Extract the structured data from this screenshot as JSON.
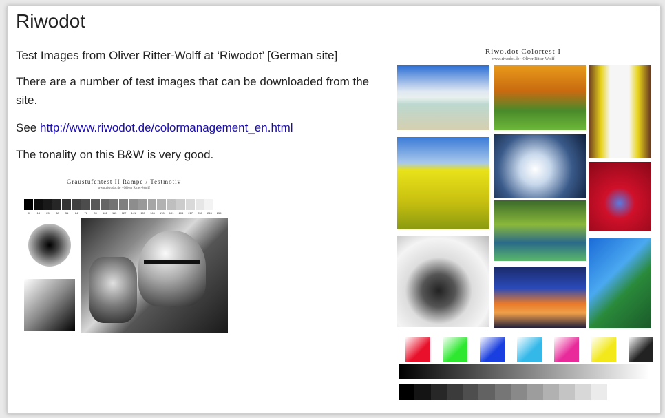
{
  "page": {
    "title": "Riwodot",
    "intro": "Test Images from Oliver Ritter-Wolff at ‘Riwodot’ [German site]",
    "para2": "There are a number of test images that can be downloaded from the site.",
    "see_label": "See ",
    "link_text": "http://www.riwodot.de/colormanagement_en.html",
    "tonality": "The tonality on this B&W is very good."
  },
  "gray_test": {
    "title": "Graustufentest II Rampe / Testmotiv",
    "subtitle": "www.riwodot.de · Oliver Ritter-Wolff",
    "ramp_values": [
      "0",
      "14",
      "25",
      "38",
      "51",
      "64",
      "76",
      "89",
      "102",
      "115",
      "127",
      "141",
      "153",
      "166",
      "178",
      "191",
      "204",
      "217",
      "230",
      "243",
      "255"
    ]
  },
  "color_test": {
    "title": "Riwo.dot Colortest I",
    "subtitle": "www.riwodot.de · Oliver Ritter-Wolff",
    "swatch_colors": [
      "#e8102a",
      "#2ee830",
      "#1a3fe0",
      "#34b8e8",
      "#e82a9a",
      "#f2e81a",
      "#222222"
    ]
  }
}
